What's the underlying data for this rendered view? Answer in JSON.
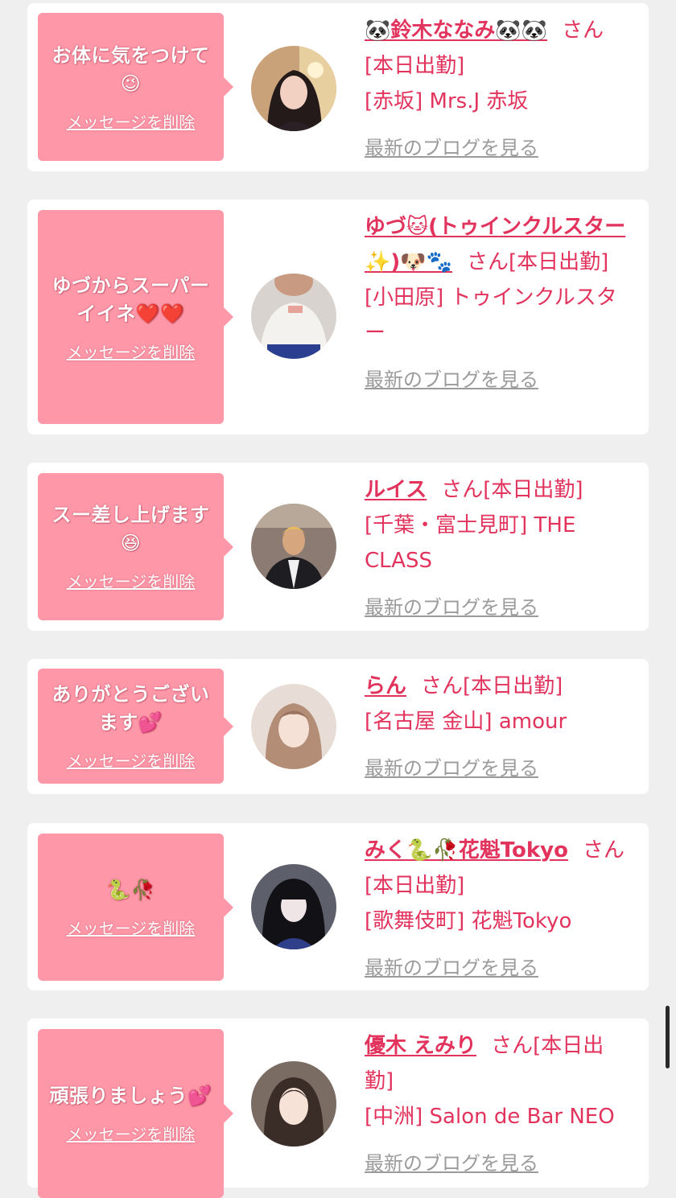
{
  "colors": {
    "background": "#efefef",
    "card": "#ffffff",
    "bubble": "#fe97a8",
    "accent_text": "#e2335d",
    "blog_link": "#9b9b9b"
  },
  "cards": [
    {
      "message": "お体に気をつけて😉",
      "delete_label": "メッセージを削除",
      "name": "🐼鈴木ななみ🐼🐼",
      "san": "さん",
      "status": "[本日出勤]",
      "shop": "[赤坂] Mrs.J 赤坂",
      "blog_label": "最新のブログを見る",
      "avatar_icon": "profile-photo"
    },
    {
      "message": "ゆづからスーパーイイネ❤️❤️",
      "delete_label": "メッセージを削除",
      "name": "ゆづ🐱(トゥインクルスター✨)🐶🐾",
      "san": "さん",
      "status": "[本日出勤]",
      "shop": "[小田原] トゥインクルスター",
      "blog_label": "最新のブログを見る",
      "avatar_icon": "profile-photo"
    },
    {
      "message": "スー差し上げます😆",
      "delete_label": "メッセージを削除",
      "name": "ルイス",
      "san": "さん",
      "status": "[本日出勤]",
      "shop": "[千葉・富士見町] THE CLASS",
      "blog_label": "最新のブログを見る",
      "avatar_icon": "profile-photo"
    },
    {
      "message": "ありがとうございます💕",
      "delete_label": "メッセージを削除",
      "name": "らん",
      "san": "さん",
      "status": "[本日出勤]",
      "shop": "[名古屋 金山] amour",
      "blog_label": "最新のブログを見る",
      "avatar_icon": "profile-photo"
    },
    {
      "message": "🐍🥀",
      "delete_label": "メッセージを削除",
      "name": "みく🐍🥀花魁Tokyo",
      "san": "さん",
      "status": "[本日出勤]",
      "shop": "[歌舞伎町] 花魁Tokyo",
      "blog_label": "最新のブログを見る",
      "avatar_icon": "profile-photo"
    },
    {
      "message": "頑張りましょう💕",
      "delete_label": "メッセージを削除",
      "name": "優木 えみり",
      "san": "さん",
      "status": "[本日出勤]",
      "shop": "[中洲] Salon de Bar NEO",
      "blog_label": "最新のブログを見る",
      "avatar_icon": "profile-photo"
    }
  ]
}
